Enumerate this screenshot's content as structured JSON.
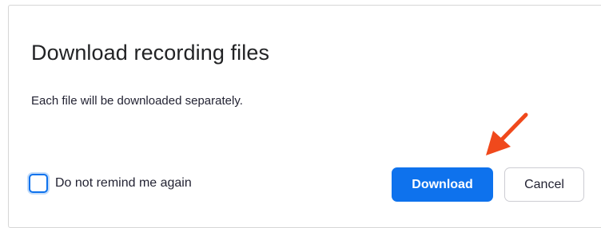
{
  "dialog": {
    "title": "Download recording files",
    "message": "Each file will be downloaded separately.",
    "remind_checkbox": {
      "label": "Do not remind me again",
      "checked": false
    },
    "download_button": "Download",
    "cancel_button": "Cancel"
  },
  "colors": {
    "primary": "#0e72ed",
    "annotation_arrow": "#f0491c",
    "text": "#232333"
  },
  "annotation": {
    "icon": "red-arrow-icon",
    "points_to": "download-button"
  }
}
